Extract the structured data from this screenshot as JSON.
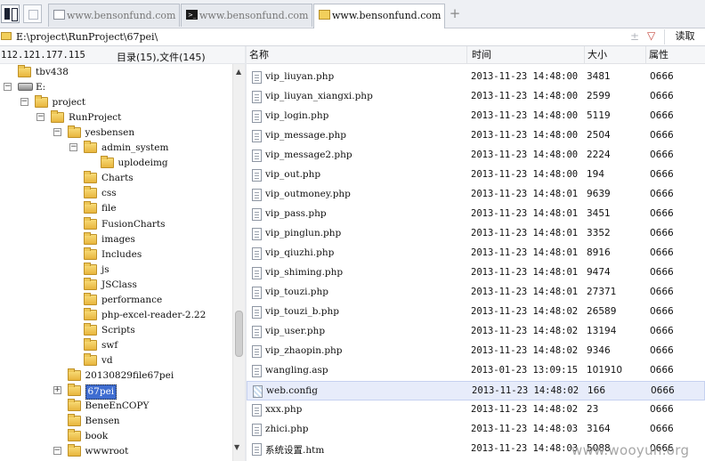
{
  "tabs": [
    {
      "label": "www.bensonfund.com",
      "icon": "blank-page-icon"
    },
    {
      "label": "www.bensonfund.com",
      "icon": "terminal-icon"
    },
    {
      "label": "www.bensonfund.com",
      "icon": "folder-icon",
      "active": true
    }
  ],
  "address": {
    "path": "E:\\project\\RunProject\\67pei\\",
    "read_label": "读取",
    "option_glyph": "±",
    "dropdown_glyph": "▽"
  },
  "left_header": {
    "ip": "112.121.177.115",
    "count": "目录(15),文件(145)"
  },
  "tree": [
    {
      "label": "tbv438",
      "indent": 0,
      "expander": ""
    },
    {
      "label": "E:",
      "indent": 0,
      "expander": "-",
      "drive": true
    },
    {
      "label": "project",
      "indent": 1,
      "expander": "-"
    },
    {
      "label": "RunProject",
      "indent": 2,
      "expander": "-"
    },
    {
      "label": "yesbensen",
      "indent": 3,
      "expander": "-"
    },
    {
      "label": "admin_system",
      "indent": 4,
      "expander": "-"
    },
    {
      "label": "uplodeimg",
      "indent": 5,
      "expander": ""
    },
    {
      "label": "Charts",
      "indent": 4,
      "expander": ""
    },
    {
      "label": "css",
      "indent": 4,
      "expander": ""
    },
    {
      "label": "file",
      "indent": 4,
      "expander": ""
    },
    {
      "label": "FusionCharts",
      "indent": 4,
      "expander": ""
    },
    {
      "label": "images",
      "indent": 4,
      "expander": ""
    },
    {
      "label": "Includes",
      "indent": 4,
      "expander": ""
    },
    {
      "label": "js",
      "indent": 4,
      "expander": ""
    },
    {
      "label": "JSClass",
      "indent": 4,
      "expander": ""
    },
    {
      "label": "performance",
      "indent": 4,
      "expander": ""
    },
    {
      "label": "php-excel-reader-2.22",
      "indent": 4,
      "expander": ""
    },
    {
      "label": "Scripts",
      "indent": 4,
      "expander": ""
    },
    {
      "label": "swf",
      "indent": 4,
      "expander": ""
    },
    {
      "label": "vd",
      "indent": 4,
      "expander": ""
    },
    {
      "label": "20130829file67pei",
      "indent": 3,
      "expander": ""
    },
    {
      "label": "67pei",
      "indent": 3,
      "expander": "+",
      "selected": true
    },
    {
      "label": "BeneEnCOPY",
      "indent": 3,
      "expander": ""
    },
    {
      "label": "Bensen",
      "indent": 3,
      "expander": ""
    },
    {
      "label": "book",
      "indent": 3,
      "expander": ""
    },
    {
      "label": "wwwroot",
      "indent": 3,
      "expander": "-"
    }
  ],
  "columns": {
    "name": "名称",
    "time": "时间",
    "size": "大小",
    "attr": "属性"
  },
  "files": [
    {
      "name": "vip_liuyan.php",
      "time": "2013-11-23 14:48:00",
      "size": "3481",
      "attr": "0666"
    },
    {
      "name": "vip_liuyan_xiangxi.php",
      "time": "2013-11-23 14:48:00",
      "size": "2599",
      "attr": "0666"
    },
    {
      "name": "vip_login.php",
      "time": "2013-11-23 14:48:00",
      "size": "5119",
      "attr": "0666"
    },
    {
      "name": "vip_message.php",
      "time": "2013-11-23 14:48:00",
      "size": "2504",
      "attr": "0666"
    },
    {
      "name": "vip_message2.php",
      "time": "2013-11-23 14:48:00",
      "size": "2224",
      "attr": "0666"
    },
    {
      "name": "vip_out.php",
      "time": "2013-11-23 14:48:00",
      "size": "194",
      "attr": "0666"
    },
    {
      "name": "vip_outmoney.php",
      "time": "2013-11-23 14:48:01",
      "size": "9639",
      "attr": "0666"
    },
    {
      "name": "vip_pass.php",
      "time": "2013-11-23 14:48:01",
      "size": "3451",
      "attr": "0666"
    },
    {
      "name": "vip_pinglun.php",
      "time": "2013-11-23 14:48:01",
      "size": "3352",
      "attr": "0666"
    },
    {
      "name": "vip_qiuzhi.php",
      "time": "2013-11-23 14:48:01",
      "size": "8916",
      "attr": "0666"
    },
    {
      "name": "vip_shiming.php",
      "time": "2013-11-23 14:48:01",
      "size": "9474",
      "attr": "0666"
    },
    {
      "name": "vip_touzi.php",
      "time": "2013-11-23 14:48:01",
      "size": "27371",
      "attr": "0666"
    },
    {
      "name": "vip_touzi_b.php",
      "time": "2013-11-23 14:48:02",
      "size": "26589",
      "attr": "0666"
    },
    {
      "name": "vip_user.php",
      "time": "2013-11-23 14:48:02",
      "size": "13194",
      "attr": "0666"
    },
    {
      "name": "vip_zhaopin.php",
      "time": "2013-11-23 14:48:02",
      "size": "9346",
      "attr": "0666"
    },
    {
      "name": "wangling.asp",
      "time": "2013-01-23 13:09:15",
      "size": "101910",
      "attr": "0666"
    },
    {
      "name": "web.config",
      "time": "2013-11-23 14:48:02",
      "size": "166",
      "attr": "0666",
      "selected": true,
      "icon": "config-file-icon"
    },
    {
      "name": "xxx.php",
      "time": "2013-11-23 14:48:02",
      "size": "23",
      "attr": "0666"
    },
    {
      "name": "zhici.php",
      "time": "2013-11-23 14:48:03",
      "size": "3164",
      "attr": "0666"
    },
    {
      "name": "系统设置.htm",
      "time": "2013-11-23 14:48:03",
      "size": "5088",
      "attr": "0666"
    }
  ],
  "watermark": "www.wooyun.org"
}
